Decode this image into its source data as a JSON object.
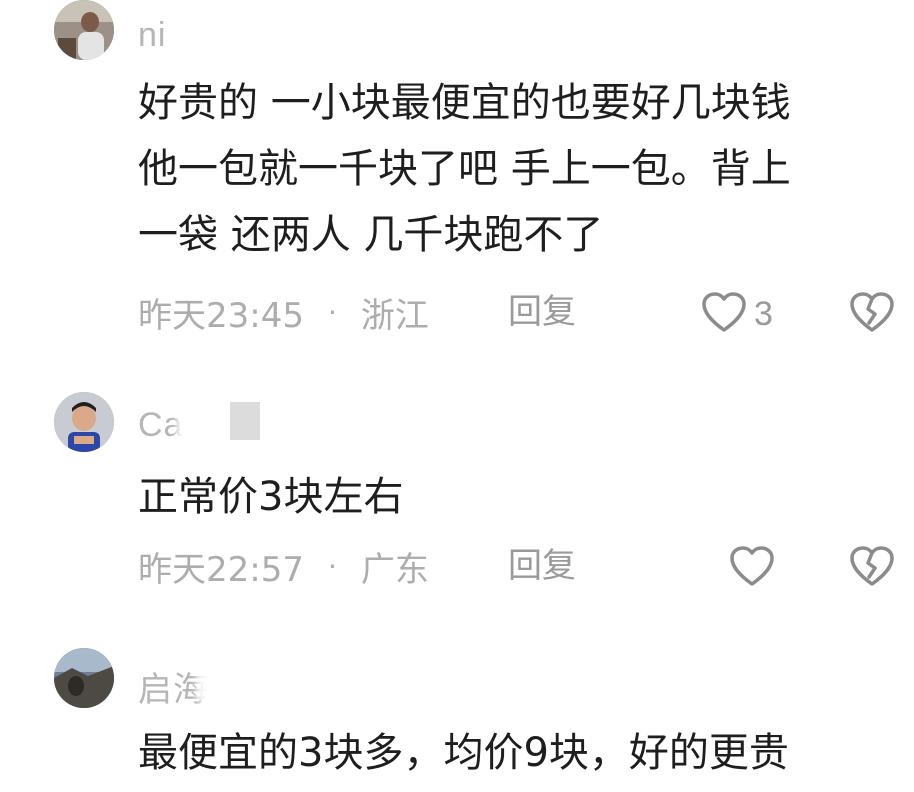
{
  "comments": [
    {
      "username": "ni",
      "text_lines": [
        "好贵的 一小块最便宜的也要好几块钱",
        "他一包就一千块了吧 手上一包。背上",
        "一袋 还两人 几千块跑不了"
      ],
      "time": "昨天23:45",
      "location": "浙江",
      "reply_label": "回复",
      "like_count": "3"
    },
    {
      "username": "Ca",
      "text_lines": [
        "正常价3块左右"
      ],
      "time": "昨天22:57",
      "location": "广东",
      "reply_label": "回复",
      "like_count": ""
    },
    {
      "username": "启海",
      "text_lines": [
        "最便宜的3块多，均价9块，好的更贵"
      ]
    }
  ],
  "separator": "·",
  "icons": {
    "like": "heart-outline-icon",
    "dislike": "broken-heart-icon"
  },
  "colors": {
    "meta_text": "#adadad",
    "body_text": "#1e1e1e",
    "icon_stroke": "#8c8c8c"
  }
}
